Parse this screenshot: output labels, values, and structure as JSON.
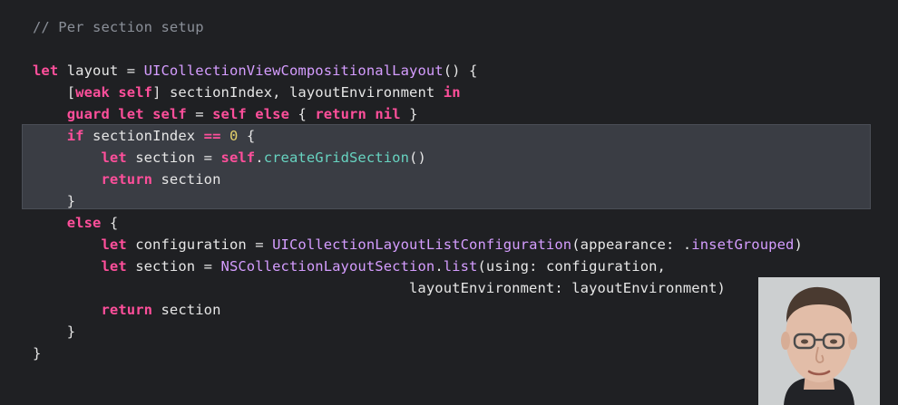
{
  "code": {
    "lines": [
      [
        {
          "t": "// Per section setup",
          "c": "comment"
        }
      ],
      [],
      [
        {
          "t": "let",
          "c": "kw"
        },
        {
          "t": " layout = ",
          "c": "plain"
        },
        {
          "t": "UICollectionViewCompositionalLayout",
          "c": "type"
        },
        {
          "t": "() {",
          "c": "plain"
        }
      ],
      [
        {
          "t": "    [",
          "c": "plain"
        },
        {
          "t": "weak",
          "c": "kw"
        },
        {
          "t": " ",
          "c": "plain"
        },
        {
          "t": "self",
          "c": "kw"
        },
        {
          "t": "] sectionIndex, layoutEnvironment ",
          "c": "plain"
        },
        {
          "t": "in",
          "c": "kw"
        }
      ],
      [
        {
          "t": "    ",
          "c": "plain"
        },
        {
          "t": "guard",
          "c": "kw"
        },
        {
          "t": " ",
          "c": "plain"
        },
        {
          "t": "let",
          "c": "kw"
        },
        {
          "t": " ",
          "c": "plain"
        },
        {
          "t": "self",
          "c": "kw"
        },
        {
          "t": " = ",
          "c": "plain"
        },
        {
          "t": "self",
          "c": "kw"
        },
        {
          "t": " ",
          "c": "plain"
        },
        {
          "t": "else",
          "c": "kw"
        },
        {
          "t": " { ",
          "c": "plain"
        },
        {
          "t": "return",
          "c": "kw"
        },
        {
          "t": " ",
          "c": "plain"
        },
        {
          "t": "nil",
          "c": "kw"
        },
        {
          "t": " }",
          "c": "plain"
        }
      ],
      [
        {
          "t": "    ",
          "c": "plain"
        },
        {
          "t": "if",
          "c": "kw"
        },
        {
          "t": " sectionIndex ",
          "c": "plain"
        },
        {
          "t": "==",
          "c": "kw"
        },
        {
          "t": " ",
          "c": "plain"
        },
        {
          "t": "0",
          "c": "num"
        },
        {
          "t": " {",
          "c": "plain"
        }
      ],
      [
        {
          "t": "        ",
          "c": "plain"
        },
        {
          "t": "let",
          "c": "kw"
        },
        {
          "t": " section = ",
          "c": "plain"
        },
        {
          "t": "self",
          "c": "kw"
        },
        {
          "t": ".",
          "c": "plain"
        },
        {
          "t": "createGridSection",
          "c": "func"
        },
        {
          "t": "()",
          "c": "plain"
        }
      ],
      [
        {
          "t": "        ",
          "c": "plain"
        },
        {
          "t": "return",
          "c": "kw"
        },
        {
          "t": " section",
          "c": "plain"
        }
      ],
      [
        {
          "t": "    }",
          "c": "plain"
        }
      ],
      [
        {
          "t": "    ",
          "c": "plain"
        },
        {
          "t": "else",
          "c": "kw"
        },
        {
          "t": " {",
          "c": "plain"
        }
      ],
      [
        {
          "t": "        ",
          "c": "plain"
        },
        {
          "t": "let",
          "c": "kw"
        },
        {
          "t": " configuration = ",
          "c": "plain"
        },
        {
          "t": "UICollectionLayoutListConfiguration",
          "c": "type"
        },
        {
          "t": "(appearance: .",
          "c": "plain"
        },
        {
          "t": "insetGrouped",
          "c": "type"
        },
        {
          "t": ")",
          "c": "plain"
        }
      ],
      [
        {
          "t": "        ",
          "c": "plain"
        },
        {
          "t": "let",
          "c": "kw"
        },
        {
          "t": " section = ",
          "c": "plain"
        },
        {
          "t": "NSCollectionLayoutSection",
          "c": "type"
        },
        {
          "t": ".",
          "c": "plain"
        },
        {
          "t": "list",
          "c": "type"
        },
        {
          "t": "(using: configuration,",
          "c": "plain"
        }
      ],
      [
        {
          "t": "                                            layoutEnvironment: layoutEnvironment)",
          "c": "plain"
        }
      ],
      [
        {
          "t": "        ",
          "c": "plain"
        },
        {
          "t": "return",
          "c": "kw"
        },
        {
          "t": " section",
          "c": "plain"
        }
      ],
      [
        {
          "t": "    }",
          "c": "plain"
        }
      ],
      [
        {
          "t": "}",
          "c": "plain"
        }
      ]
    ]
  },
  "colors": {
    "background": "#1f2023",
    "highlight": "#3a3d44",
    "keyword": "#ff4f9b",
    "type": "#d59dff",
    "function": "#67d3c0",
    "number": "#e4d06a",
    "comment": "#8a8f98",
    "plain": "#e6e6e6"
  },
  "webcam": {
    "icon": "presenter-video"
  }
}
